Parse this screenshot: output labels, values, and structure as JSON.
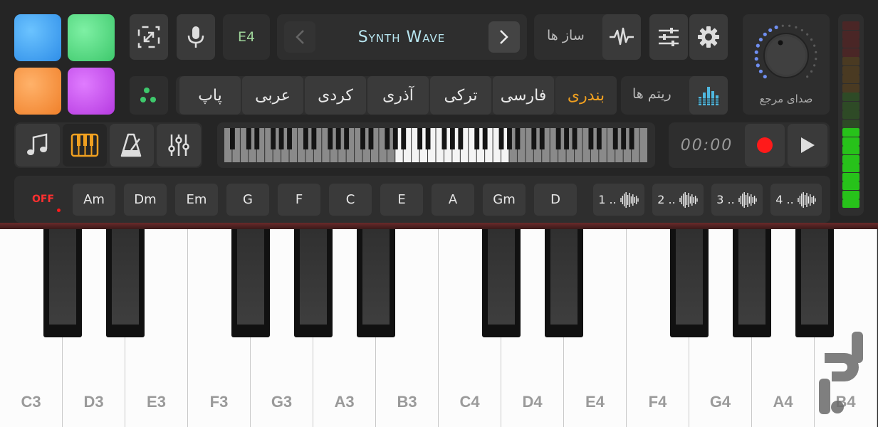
{
  "colors": {
    "pad_blue": "#3f9ff0",
    "pad_green": "#4fd77e",
    "pad_orange": "#f5903a",
    "pad_purple": "#c84be8",
    "accent_orange": "#f0a020",
    "record_red": "#ff1a1a",
    "meter_green": "#27c21a",
    "divider_red": "#6a2a2a"
  },
  "toolbar": {
    "octave_label": "E4",
    "instrument_name": "Synth Wave",
    "instruments_label": "ساز ها",
    "rhythms_label": "ریتم ها",
    "reference_sound_label": "صدای مرجع",
    "timer": "00:00"
  },
  "styles": [
    {
      "label": "پاپ",
      "active": false
    },
    {
      "label": "عربی",
      "active": false
    },
    {
      "label": "کردی",
      "active": false
    },
    {
      "label": "آذری",
      "active": false
    },
    {
      "label": "ترکی",
      "active": false
    },
    {
      "label": "فارسی",
      "active": false
    },
    {
      "label": "بندری",
      "active": true
    }
  ],
  "chords": {
    "off_label": "OFF",
    "items": [
      "Am",
      "Dm",
      "Em",
      "G",
      "F",
      "C",
      "E",
      "A",
      "Gm",
      "D"
    ]
  },
  "rhythm_slots": [
    "1 ..",
    "2 ..",
    "3 ..",
    "4 .."
  ],
  "keyboard": {
    "white_keys": [
      "C3",
      "D3",
      "E3",
      "F3",
      "G3",
      "A3",
      "B3",
      "C4",
      "D4",
      "E4",
      "F4",
      "G4",
      "A4",
      "B4"
    ]
  },
  "level_meter": {
    "lit_segments": 9,
    "total_segments": 21
  },
  "icons": {
    "expand": "expand-arrows-icon",
    "mic": "microphone-icon",
    "prev": "chevron-left-icon",
    "next": "chevron-right-icon",
    "waveform": "waveform-icon",
    "mixer": "sliders-icon",
    "settings": "gear-icon",
    "dots": "dots-icon",
    "equalizer": "equalizer-icon",
    "note": "music-note-icon",
    "piano": "piano-icon",
    "metronome": "metronome-icon",
    "faders": "faders-icon",
    "record": "record-icon",
    "play": "play-icon"
  }
}
